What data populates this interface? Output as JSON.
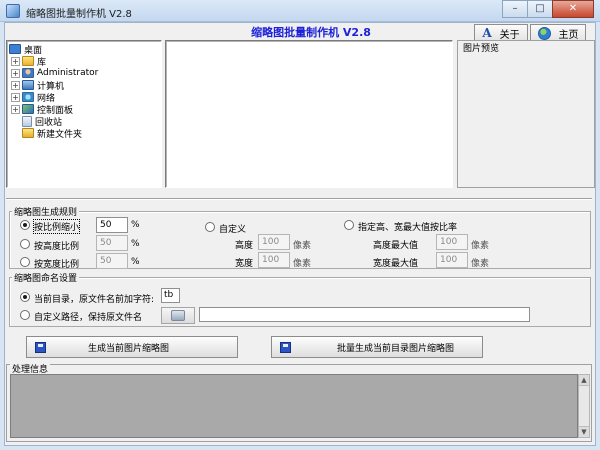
{
  "window": {
    "title": "缩略图批量制作机 V2.8",
    "minimize": "–",
    "maximize": "□",
    "close": "✕"
  },
  "header": {
    "heading": "缩略图批量制作机 V2.8",
    "about_label": "关于",
    "home_label": "主页"
  },
  "tree": {
    "items": [
      {
        "label": "桌面",
        "icon": "desktop-icon",
        "expander": ""
      },
      {
        "label": "库",
        "icon": "library-icon",
        "expander": "+"
      },
      {
        "label": "Administrator",
        "icon": "user-icon",
        "expander": "+"
      },
      {
        "label": "计算机",
        "icon": "computer-icon",
        "expander": "+"
      },
      {
        "label": "网络",
        "icon": "network-icon",
        "expander": "+"
      },
      {
        "label": "控制面板",
        "icon": "control-panel-icon",
        "expander": "+"
      },
      {
        "label": "回收站",
        "icon": "recycle-icon",
        "expander": ""
      },
      {
        "label": "新建文件夹",
        "icon": "folder-icon",
        "expander": ""
      }
    ]
  },
  "preview": {
    "label": "图片预览"
  },
  "rules": {
    "caption": "缩略图生成规则",
    "by_ratio": {
      "label": "按比例缩小",
      "value": "50",
      "unit": "%"
    },
    "by_height": {
      "label": "按高度比例",
      "value": "50",
      "unit": "%"
    },
    "by_width": {
      "label": "按宽度比例",
      "value": "50",
      "unit": "%"
    },
    "custom": {
      "label": "自定义",
      "height_label": "高度",
      "height_value": "100",
      "width_label": "宽度",
      "width_value": "100",
      "unit": "像素"
    },
    "max_ratio": {
      "label": "指定高、宽最大值按比率",
      "max_height_label": "高度最大值",
      "max_height_value": "100",
      "max_width_label": "宽度最大值",
      "max_width_value": "100",
      "unit": "像素"
    }
  },
  "naming": {
    "caption": "缩略图命名设置",
    "current_dir": {
      "label": "当前目录，原文件名前加字符:",
      "value": "tb"
    },
    "custom_path": {
      "label": "自定义路径，保持原文件名",
      "value": ""
    }
  },
  "actions": {
    "generate_current": "生成当前图片缩略图",
    "generate_all": "批量生成当前目录图片缩略图"
  },
  "log": {
    "caption": "处理信息",
    "content": ""
  }
}
